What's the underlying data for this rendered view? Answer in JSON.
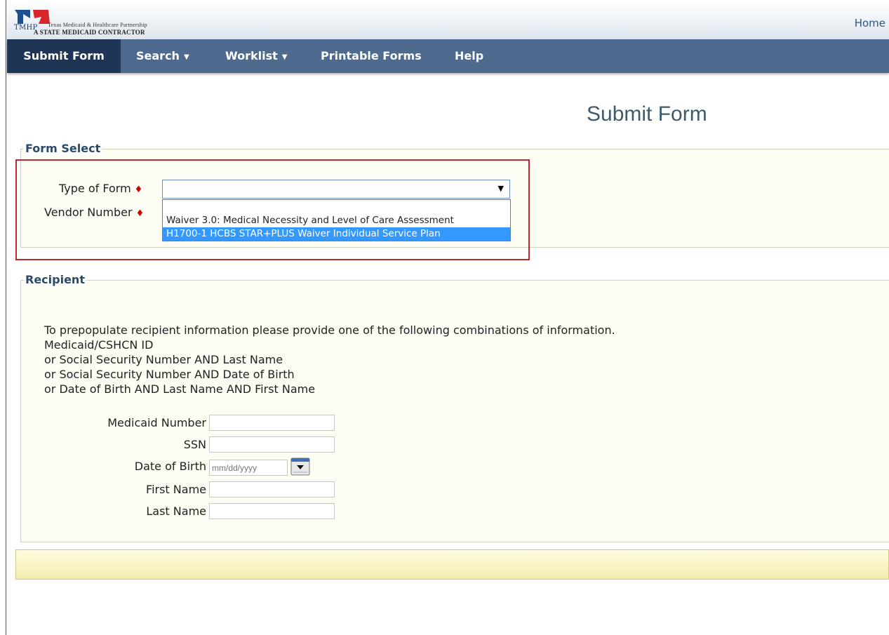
{
  "header": {
    "logo_text": "TMHP",
    "org_line1": "Texas Medicaid & Healthcare Partnership",
    "org_line2": "A STATE MEDICAID CONTRACTOR",
    "home_link": "Home"
  },
  "nav": {
    "items": [
      {
        "label": "Submit Form",
        "active": true
      },
      {
        "label": "Search",
        "dropdown": true
      },
      {
        "label": "Worklist",
        "dropdown": true
      },
      {
        "label": "Printable Forms"
      },
      {
        "label": "Help"
      }
    ],
    "caret": "▼"
  },
  "page": {
    "title": "Submit Form"
  },
  "form_select": {
    "legend": "Form Select",
    "type_of_form_label": "Type of Form",
    "vendor_number_label": "Vendor Number",
    "required_marker": "♦",
    "select_value": "",
    "select_arrow": "▼",
    "dropdown_options": [
      {
        "label": "",
        "selected": false
      },
      {
        "label": "Waiver 3.0: Medical Necessity and Level of Care Assessment",
        "selected": false
      },
      {
        "label": "H1700-1 HCBS STAR+PLUS Waiver Individual Service Plan",
        "selected": true
      }
    ]
  },
  "recipient": {
    "legend": "Recipient",
    "instructions": [
      "To prepopulate recipient information please provide one of the following combinations of information.",
      "Medicaid/CSHCN ID",
      "or Social Security Number AND Last Name",
      "or Social Security Number AND Date of Birth",
      "or Date of Birth AND Last Name AND First Name"
    ],
    "fields": {
      "medicaid_number_label": "Medicaid Number",
      "ssn_label": "SSN",
      "dob_label": "Date of Birth",
      "dob_placeholder": "mm/dd/yyyy",
      "first_name_label": "First Name",
      "last_name_label": "Last Name"
    }
  },
  "colors": {
    "nav_bg": "#4e6b8f",
    "nav_active": "#1f3555",
    "title": "#3e5a6e",
    "required": "#cc0000",
    "selected_option": "#3399ff",
    "highlight_border": "#c0282d"
  }
}
